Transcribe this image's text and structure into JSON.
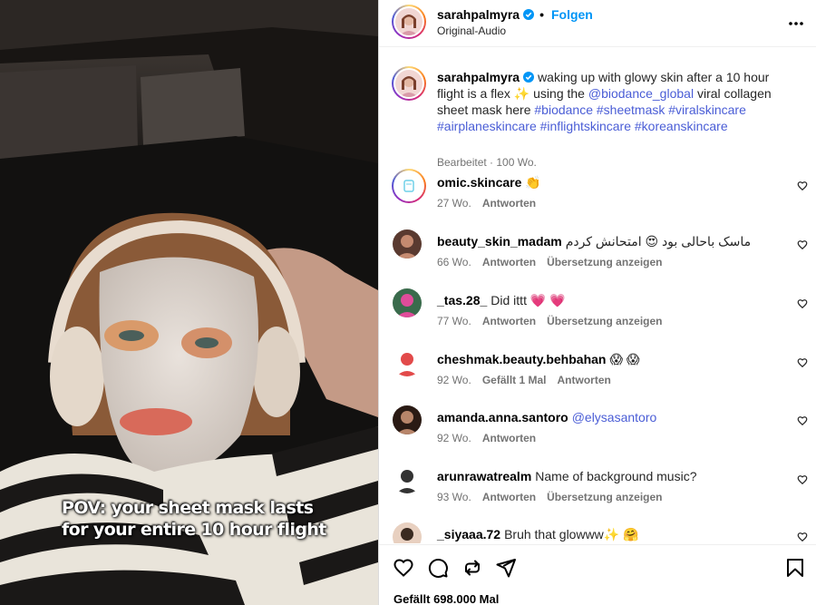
{
  "video": {
    "overlay_line1": "POV:  your sheet mask lasts",
    "overlay_line2": "for your entire 10 hour flight"
  },
  "header": {
    "username": "sarahpalmyra",
    "dot": "•",
    "follow_label": "Folgen",
    "audio_label": "Original-Audio",
    "more_icon": "more-horizontal-icon"
  },
  "caption": {
    "username": "sarahpalmyra",
    "text_1": "waking up with glowy skin after a 10 hour flight is a flex ✨ using the",
    "mention": "@biodance_global",
    "text_2": "viral collagen sheet mask here",
    "hashtags": "#biodance #sheetmask #viralskincare #airplaneskincare #inflightskincare #koreanskincare",
    "meta": "Bearbeitet · 100 Wo."
  },
  "comments": [
    {
      "username": "omic.skincare",
      "text": "👏",
      "age": "27 Wo.",
      "actions": [
        "Antworten"
      ]
    },
    {
      "username": "beauty_skin_madam",
      "text": "ماسک باحالی بود 😍 امتحانش کردم",
      "rtl": true,
      "age": "66 Wo.",
      "actions": [
        "Antworten",
        "Übersetzung anzeigen"
      ]
    },
    {
      "username": "_tas.28_",
      "text": "Did ittt 💗 💗",
      "age": "77 Wo.",
      "actions": [
        "Antworten",
        "Übersetzung anzeigen"
      ]
    },
    {
      "username": "cheshmak.beauty.behbahan",
      "text": "😱 😱",
      "age": "92 Wo.",
      "actions": [
        "Gefällt 1 Mal",
        "Antworten"
      ]
    },
    {
      "username": "amanda.anna.santoro",
      "text": "@elysasantoro",
      "is_mention": true,
      "age": "92 Wo.",
      "actions": [
        "Antworten"
      ]
    },
    {
      "username": "arunrawatrealm",
      "text": "Name of background music?",
      "age": "93 Wo.",
      "actions": [
        "Antworten",
        "Übersetzung anzeigen"
      ]
    },
    {
      "username": "_siyaaa.72",
      "text": "Bruh that glowww✨ 🤗",
      "age": "",
      "actions": []
    }
  ],
  "footer": {
    "likes": "Gefällt 698.000 Mal"
  },
  "colors": {
    "link": "#4a5dd6",
    "follow": "#0095f6",
    "verified": "#0095f6",
    "muted": "#737373"
  }
}
